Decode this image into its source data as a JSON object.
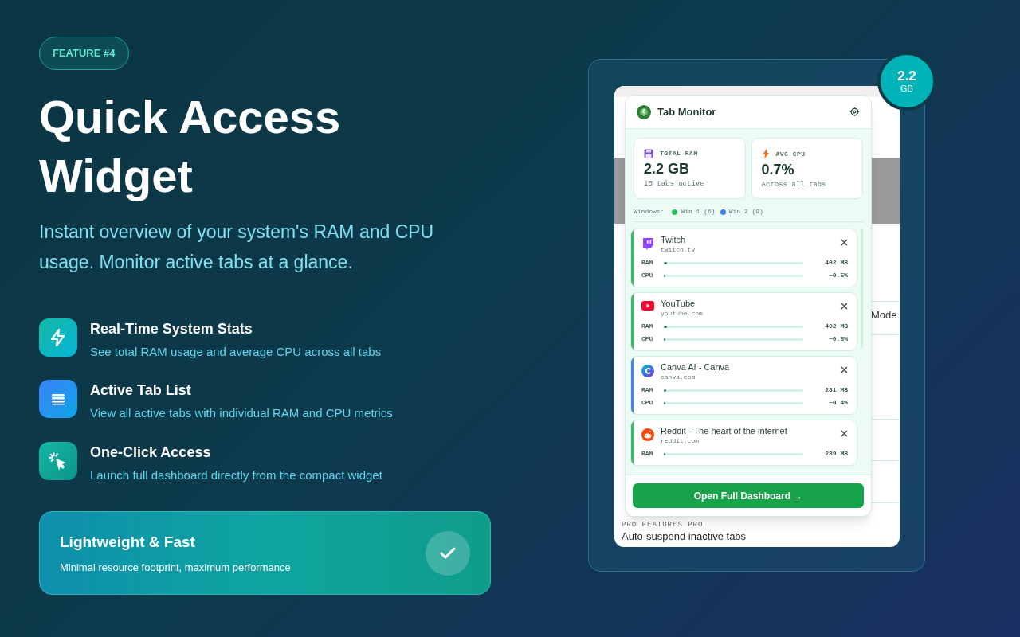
{
  "badge": "FEATURE #4",
  "title": "Quick Access Widget",
  "subtitle": "Instant overview of your system's RAM and CPU usage. Monitor active tabs at a glance.",
  "features": [
    {
      "kind": "bolt",
      "title": "Real-Time System Stats",
      "text": "See total RAM usage and average CPU across all tabs"
    },
    {
      "kind": "list",
      "title": "Active Tab List",
      "text": "View all active tabs with individual RAM and CPU metrics"
    },
    {
      "kind": "click",
      "title": "One-Click Access",
      "text": "Launch full dashboard directly from the compact widget"
    }
  ],
  "highlight": {
    "title": "Lightweight & Fast",
    "text": "Minimal resource footprint, maximum performance"
  },
  "memory_badge": {
    "value": "2.2",
    "unit": "GB"
  },
  "background_page": {
    "fragment": "Mode",
    "section_label": "PRO FEATURES PRO",
    "item": "Auto-suspend inactive tabs"
  },
  "widget": {
    "title": "Tab Monitor",
    "stats": [
      {
        "kind": "ram",
        "label": "TOTAL RAM",
        "value": "2.2 GB",
        "note": "15 tabs active"
      },
      {
        "kind": "cpu",
        "label": "AVG CPU",
        "value": "0.7%",
        "note": "Across all tabs"
      }
    ],
    "windows_label": "Windows:",
    "windows": [
      {
        "label": "Win 1 (6)",
        "color": "#22c55e"
      },
      {
        "label": "Win 2 (9)",
        "color": "#3b82f6"
      }
    ],
    "tabs": [
      {
        "kind": "twitch",
        "title": "Twitch",
        "domain": "twitch.tv",
        "color": "#22c55e",
        "metrics": [
          {
            "label": "RAM",
            "level": 0.02,
            "value": "402 MB"
          },
          {
            "label": "CPU",
            "level": 0.005,
            "value": "~0.5%"
          }
        ]
      },
      {
        "kind": "youtube",
        "title": "YouTube",
        "domain": "youtube.com",
        "color": "#22c55e",
        "metrics": [
          {
            "label": "RAM",
            "level": 0.02,
            "value": "402 MB"
          },
          {
            "label": "CPU",
            "level": 0.005,
            "value": "~0.5%"
          }
        ]
      },
      {
        "kind": "canva",
        "title": "Canva AI - Canva",
        "domain": "canva.com",
        "color": "#3b82f6",
        "metrics": [
          {
            "label": "RAM",
            "level": 0.015,
            "value": "281 MB"
          },
          {
            "label": "CPU",
            "level": 0.004,
            "value": "~0.4%"
          }
        ]
      },
      {
        "kind": "reddit",
        "title": "Reddit - The heart of the internet",
        "domain": "reddit.com",
        "color": "#22c55e",
        "metrics": [
          {
            "label": "RAM",
            "level": 0.012,
            "value": "239 MB"
          }
        ]
      }
    ],
    "button": "Open Full Dashboard →"
  }
}
